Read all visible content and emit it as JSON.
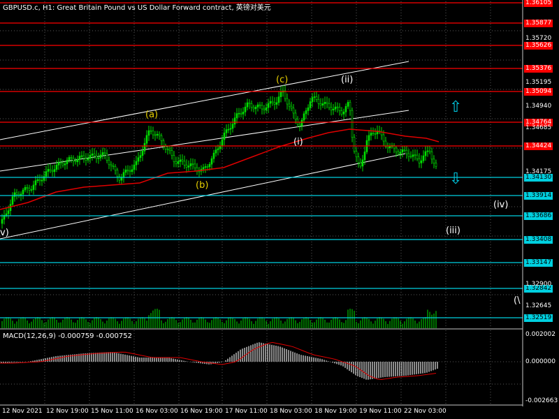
{
  "header": {
    "title": "GBPUSD.c, H1:  Great Britain Pound vs US Dollar Forward contract, 英镑对美元"
  },
  "macd": {
    "label": "MACD(12,26,9) -0.000759 -0.000752",
    "axis_labels": [
      "0.002002",
      "0.000000",
      "-0.002663"
    ]
  },
  "time_axis": {
    "labels": [
      "12 Nov 2021",
      "12 Nov 19:00",
      "15 Nov 11:00",
      "16 Nov 03:00",
      "16 Nov 19:00",
      "17 Nov 11:00",
      "18 Nov 03:00",
      "18 Nov 19:00",
      "19 Nov 11:00",
      "22 Nov 03:00"
    ]
  },
  "price_axis": {
    "labels": [
      "1.35720",
      "1.35195",
      "1.34940",
      "1.34685",
      "1.34175",
      "1.32900",
      "1.32645"
    ]
  },
  "price_levels": {
    "red": [
      "1.36105",
      "1.35877",
      "1.35626",
      "1.35376",
      "1.35094",
      "1.34764",
      "1.34424"
    ],
    "cyan": [
      "1.34130",
      "1.33914",
      "1.33686",
      "1.33408",
      "1.33147",
      "1.32842",
      "1.32519"
    ],
    "colors": {
      "red": "#ff0000",
      "cyan": "#00d0e0"
    }
  },
  "wave_labels": [
    {
      "text": "(a)",
      "color": "#e8d000"
    },
    {
      "text": "(b)",
      "color": "#e8d000"
    },
    {
      "text": "(c)",
      "color": "#e8d000"
    },
    {
      "text": "(i)",
      "color": "#ffffff"
    },
    {
      "text": "(ii)",
      "color": "#ffffff"
    },
    {
      "text": "(iii)",
      "color": "#ffffff"
    },
    {
      "text": "(iv)",
      "color": "#ffffff"
    },
    {
      "text": "v)",
      "color": "#ffffff"
    },
    {
      "text": "(\\",
      "color": "#ffffff"
    }
  ],
  "icons": {
    "up": "up-arrow-icon",
    "down": "down-arrow-icon"
  },
  "colors": {
    "background": "#000000",
    "candles": "#00e000",
    "moving_average": "#e00000",
    "channel": "#ffffff",
    "grid": "#5a5a5a"
  }
}
